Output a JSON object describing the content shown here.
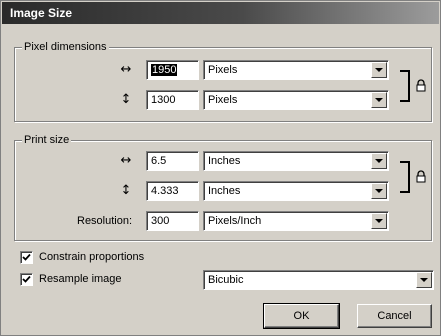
{
  "window": {
    "title": "Image Size"
  },
  "pixel_dimensions": {
    "label": "Pixel dimensions",
    "width_icon": "↔",
    "height_icon": "↕",
    "width_value": "1950",
    "width_unit": "Pixels",
    "height_value": "1300",
    "height_unit": "Pixels"
  },
  "print_size": {
    "label": "Print size",
    "width_icon": "↔",
    "height_icon": "↕",
    "width_value": "6.5",
    "width_unit": "Inches",
    "height_value": "4.333",
    "height_unit": "Inches",
    "resolution_label": "Resolution:",
    "resolution_value": "300",
    "resolution_unit": "Pixels/Inch"
  },
  "options": {
    "constrain_label": "Constrain proportions",
    "constrain_checked": true,
    "resample_label": "Resample image",
    "resample_checked": true,
    "resample_method": "Bicubic"
  },
  "buttons": {
    "ok": "OK",
    "cancel": "Cancel"
  },
  "icons": {
    "lock": "lock-icon",
    "dropdown": "chevron-down-icon",
    "check": "checkmark-icon"
  }
}
